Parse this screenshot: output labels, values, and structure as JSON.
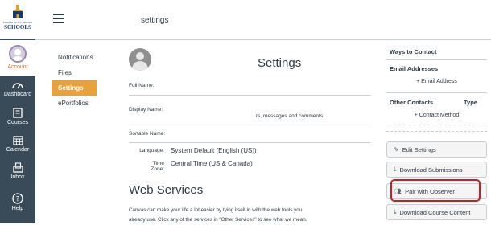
{
  "global_nav": {
    "logo_line1": "POWERHOUSE UNIFIED",
    "logo_line2": "SCHOOLS",
    "items": [
      {
        "label": "Account"
      },
      {
        "label": "Dashboard"
      },
      {
        "label": "Courses"
      },
      {
        "label": "Calendar"
      },
      {
        "label": "Inbox"
      },
      {
        "label": "Help"
      }
    ]
  },
  "header": {
    "breadcrumb": "settings"
  },
  "sub_nav": [
    "Notifications",
    "Files",
    "Settings",
    "ePortfolios"
  ],
  "main": {
    "title": "Settings",
    "full_name_label": "Full Name:",
    "display_name_label": "Display Name:",
    "display_name_hint": "rs, messages and comments.",
    "sortable_name_label": "Sortable Name:",
    "language_label": "Language:",
    "language_value": "System Default (English (US))",
    "timezone_label": "Time Zone:",
    "timezone_value": "Central Time (US & Canada)",
    "web_services_title": "Web Services",
    "web_services_desc_1": "Canvas can make your life a lot easier by tying itself in with the web tools you",
    "web_services_desc_2": "already use. Click any of the services in \"Other Services\" to see what we mean."
  },
  "sidebar": {
    "ways_to_contact": "Ways to Contact",
    "email_addresses": "Email Addresses",
    "add_email": "+ Email Address",
    "other_contacts": "Other Contacts",
    "type_label": "Type",
    "add_contact": "+ Contact Method",
    "buttons": {
      "edit_settings": "Edit Settings",
      "download_submissions": "Download Submissions",
      "pair_with_observer": "Pair with Observer",
      "download_course_content": "Download Course Content"
    }
  },
  "colors": {
    "nav_bg": "#394b58",
    "active_tab": "#e8a23d",
    "highlight": "#e0141c"
  }
}
